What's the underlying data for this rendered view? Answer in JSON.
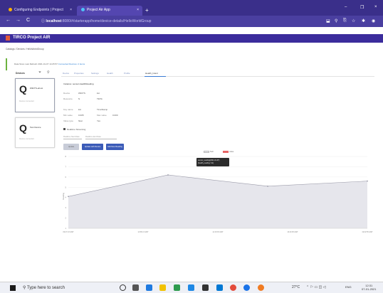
{
  "browser": {
    "tabs": [
      {
        "label": "Configuring Endpoints | Project",
        "close": "×"
      },
      {
        "label": "Project Air App",
        "close": "×"
      }
    ],
    "new_tab": "+",
    "window_controls": {
      "minimize": "–",
      "restore": "❐",
      "close": "×"
    },
    "back": "←",
    "forward": "→",
    "reload": "C",
    "url_host": "localhost",
    "url_path": ":8080/#/starterapp/home/device-details/HelloWorldGroup"
  },
  "app": {
    "title": "TIRCO Project AIR",
    "breadcrumb": "Catalogs / Devices / HelloWorldGroup",
    "status": {
      "prefix": "Data Store",
      "status_label": "Last Refresh",
      "timestamp": "2021-01-07 14:25:57",
      "tag": "Connected Devices: 2 items"
    }
  },
  "devices": {
    "heading": "Devices",
    "items": [
      {
        "name": "WiFiTS-ehost",
        "sub": "Device connected"
      },
      {
        "name": "Test Device",
        "sub": "Device connected"
      }
    ]
  },
  "main_tabs": [
    "Device",
    "Properties",
    "Settings",
    "Health",
    "Profile",
    "Health_Intent"
  ],
  "details": {
    "heading": "Instance: sensor.HealthReading",
    "rows": [
      {
        "k": "Device",
        "v": "WiFiTS",
        "v2": "kst"
      },
      {
        "k": "Resource",
        "v": "N",
        "v2": "TikTik"
      },
      {
        "k": "Key name",
        "v": "kst",
        "v2": "TimeStamp"
      },
      {
        "k": "Min value",
        "v": "0.005",
        "v2": "Max value",
        "v3": "0.000"
      },
      {
        "k": "Value type",
        "v": "float",
        "v2": "Yes"
      }
    ],
    "checkbox_label": "Realtime Streaming",
    "inputs": [
      "Realtime Start Date",
      "Realtime End Date"
    ],
    "buttons": [
      "Update",
      "Update with Device",
      "Add New Reading"
    ]
  },
  "chart_data": {
    "type": "area",
    "series": [
      {
        "name": "sensor",
        "values": [
          4.1,
          6.2,
          5.1,
          5.6
        ]
      }
    ],
    "x": [
      "09:27:23 GMT",
      "11:58:13 GMT",
      "14:18:35 GMT",
      "16:40:05 GMT",
      "19:32:55 GMT"
    ],
    "legend": [
      {
        "name": "Null",
        "color": "#e8e8ee"
      },
      {
        "name": "value",
        "color": "#e66565"
      }
    ],
    "y_ticks": [
      "1",
      "2",
      "3",
      "4",
      "5",
      "6",
      "7",
      "8"
    ],
    "ylabel": "Reading",
    "ylim": [
      1,
      8
    ],
    "tooltip": [
      "sensor_reading(2021-01-07)",
      "(health_reading: 6.2)"
    ],
    "grid": true
  },
  "taskbar": {
    "search_placeholder": "Type here to search",
    "temperature": "27°C",
    "tray_text": "ENG",
    "time": "12:31",
    "date": "07-01-2021"
  }
}
